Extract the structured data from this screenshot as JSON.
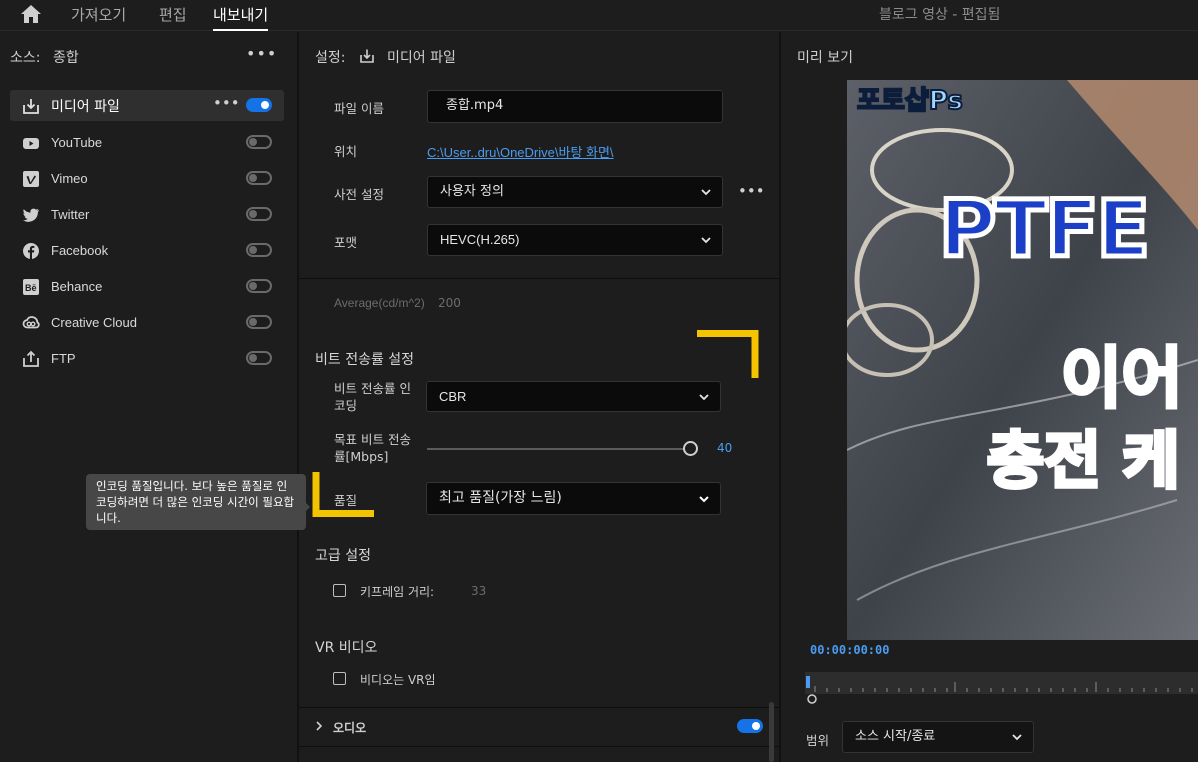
{
  "app": {
    "nav_tabs": [
      "가져오기",
      "편집",
      "내보내기"
    ],
    "active_tab": "내보내기",
    "window_title": "블로그 영상 - 편집됨"
  },
  "source": {
    "label": "소스:",
    "value": "종합",
    "destinations": [
      {
        "name": "미디어 파일",
        "icon": "media-file-icon",
        "enabled": true
      },
      {
        "name": "YouTube",
        "icon": "youtube-icon",
        "enabled": false
      },
      {
        "name": "Vimeo",
        "icon": "vimeo-icon",
        "enabled": false
      },
      {
        "name": "Twitter",
        "icon": "twitter-icon",
        "enabled": false
      },
      {
        "name": "Facebook",
        "icon": "facebook-icon",
        "enabled": false
      },
      {
        "name": "Behance",
        "icon": "behance-icon",
        "enabled": false
      },
      {
        "name": "Creative Cloud",
        "icon": "creative-cloud-icon",
        "enabled": false
      },
      {
        "name": "FTP",
        "icon": "ftp-icon",
        "enabled": false
      }
    ]
  },
  "tooltip": {
    "text": "인코딩 품질입니다. 보다 높은 품질로 인코딩하려면 더 많은 인코딩 시간이 필요합니다."
  },
  "settings": {
    "header_label": "설정:",
    "header_value": "미디어 파일",
    "filename_label": "파일 이름",
    "filename_value": "종합.mp4",
    "location_label": "위치",
    "location_value": "C:\\User..dru\\OneDrive\\바탕 화면\\",
    "preset_label": "사전 설정",
    "preset_value": "사용자 정의",
    "format_label": "포맷",
    "format_value": "HEVC(H.265)",
    "average_label": "Average(cd/m^2)",
    "average_value": "200",
    "bitrate_section": "비트 전송률 설정",
    "bitrate_encoding_label": "비트 전송률 인코딩",
    "bitrate_encoding_value": "CBR",
    "target_bitrate_label": "목표 비트 전송률[Mbps]",
    "target_bitrate_value": "40",
    "target_bitrate_fraction": 1.0,
    "quality_label": "품질",
    "quality_value": "최고 품질(가장 느림)",
    "advanced_section": "고급 설정",
    "keyframe_label": "키프레임 거리:",
    "keyframe_value": "33",
    "vr_section": "VR 비디오",
    "vr_checkbox_label": "비디오는 VR임",
    "audio_label": "오디오",
    "audio_enabled": true
  },
  "preview": {
    "label": "미리 보기",
    "overlay_badge": "포토샵Ps",
    "overlay_title": "PTFE",
    "overlay_line2": "이어",
    "overlay_line3": "충전 케",
    "timecode": "00:00:00:00",
    "range_label": "범위",
    "range_value": "소스 시작/종료"
  },
  "colors": {
    "accent": "#1473e6",
    "link": "#4b9cf0",
    "annotation": "#f5c400"
  }
}
